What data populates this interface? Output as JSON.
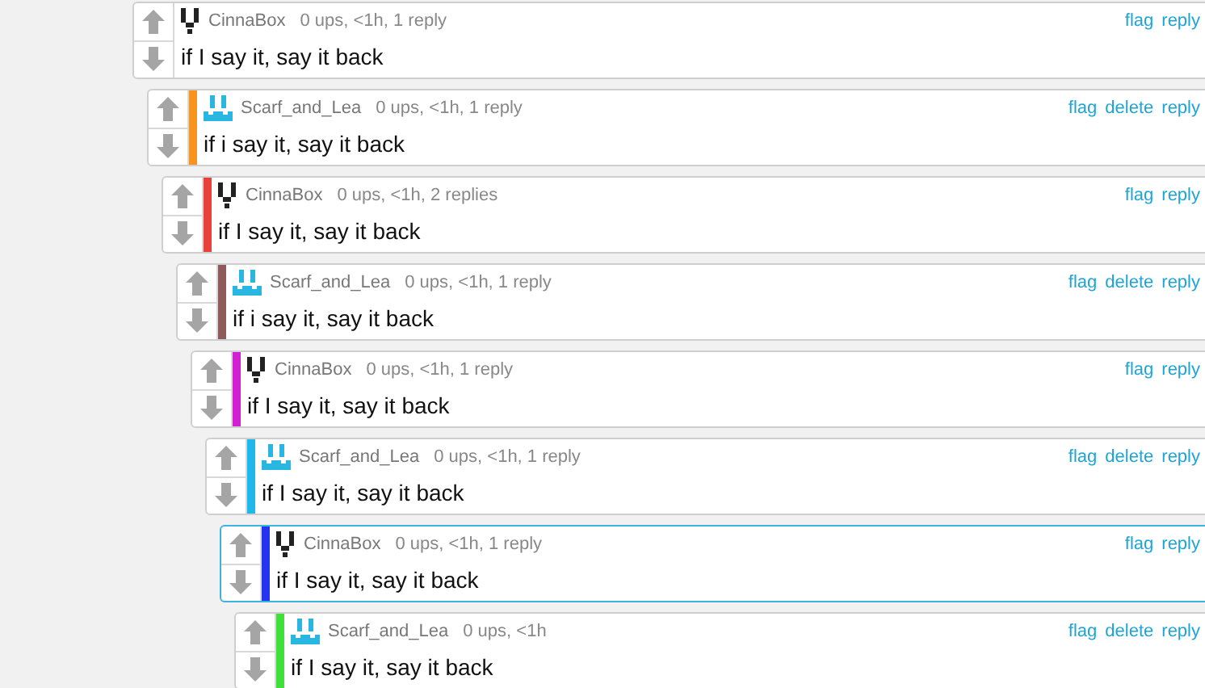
{
  "comments": [
    {
      "user": "CinnaBox",
      "kind": "dark",
      "meta": "0 ups, <1h, 1 reply",
      "text": "if I say it, say it back",
      "actions": [
        "flag",
        "reply"
      ],
      "highlighted": false,
      "children": [
        {
          "user": "Scarf_and_Lea",
          "kind": "cyan",
          "color": "#f7941d",
          "meta": "0 ups, <1h, 1 reply",
          "text": "if i say it, say it back",
          "actions": [
            "flag",
            "delete",
            "reply"
          ],
          "highlighted": false,
          "children": [
            {
              "user": "CinnaBox",
              "kind": "dark",
              "color": "#e8403a",
              "meta": "0 ups, <1h, 2 replies",
              "text": "if I say it, say it back",
              "actions": [
                "flag",
                "reply"
              ],
              "highlighted": false,
              "children": [
                {
                  "user": "Scarf_and_Lea",
                  "kind": "cyan",
                  "color": "#8e5a5a",
                  "meta": "0 ups, <1h, 1 reply",
                  "text": "if i say it, say it back",
                  "actions": [
                    "flag",
                    "delete",
                    "reply"
                  ],
                  "highlighted": false,
                  "children": [
                    {
                      "user": "CinnaBox",
                      "kind": "dark",
                      "color": "#d21fd2",
                      "meta": "0 ups, <1h, 1 reply",
                      "text": "if I say it, say it back",
                      "actions": [
                        "flag",
                        "reply"
                      ],
                      "highlighted": false,
                      "children": [
                        {
                          "user": "Scarf_and_Lea",
                          "kind": "cyan",
                          "color": "#1fb8ea",
                          "meta": "0 ups, <1h, 1 reply",
                          "text": "if I say it, say it back",
                          "actions": [
                            "flag",
                            "delete",
                            "reply"
                          ],
                          "highlighted": false,
                          "children": [
                            {
                              "user": "CinnaBox",
                              "kind": "dark",
                              "color": "#2433f0",
                              "meta": "0 ups, <1h, 1 reply",
                              "text": "if I say it, say it back",
                              "actions": [
                                "flag",
                                "reply"
                              ],
                              "highlighted": true,
                              "children": [
                                {
                                  "user": "Scarf_and_Lea",
                                  "kind": "cyan",
                                  "color": "#3fe03a",
                                  "meta": "0 ups, <1h",
                                  "text": "if I say it, say it back",
                                  "actions": [
                                    "flag",
                                    "delete",
                                    "reply"
                                  ],
                                  "highlighted": false
                                }
                              ]
                            }
                          ]
                        }
                      ]
                    }
                  ]
                }
              ]
            }
          ]
        }
      ]
    }
  ]
}
